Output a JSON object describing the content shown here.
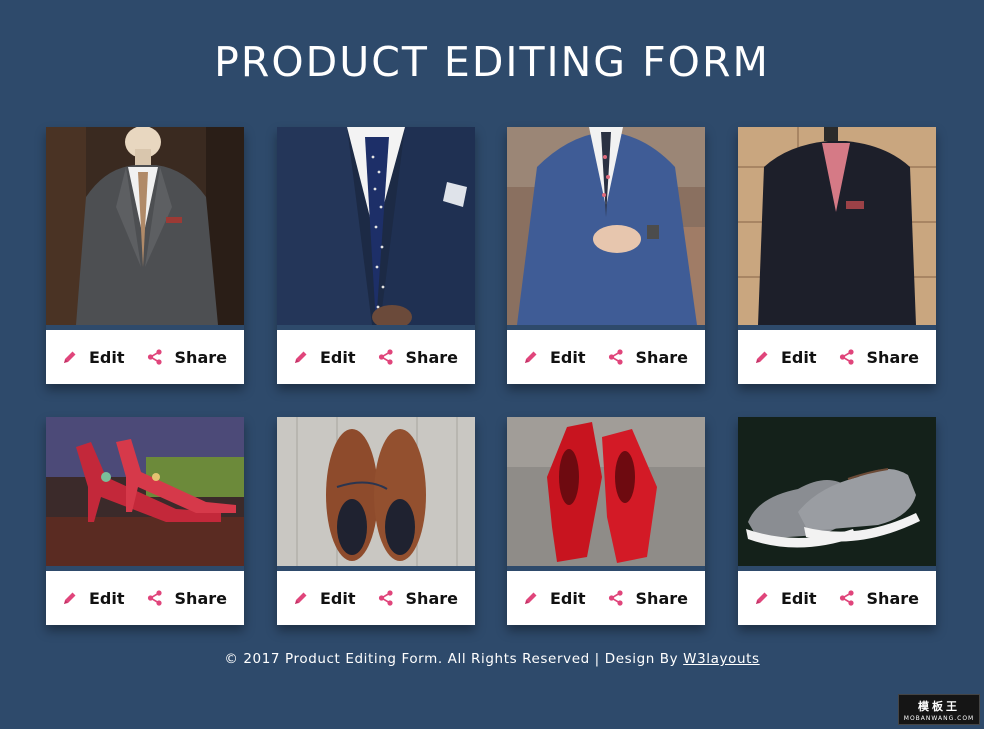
{
  "header": {
    "title": "PRODUCT EDITING FORM"
  },
  "products": [
    {
      "name": "grey-suit-mannequin",
      "edit_label": "Edit",
      "share_label": "Share"
    },
    {
      "name": "navy-suit-polka-tie",
      "edit_label": "Edit",
      "share_label": "Share"
    },
    {
      "name": "blue-suit-floral-tie",
      "edit_label": "Edit",
      "share_label": "Share"
    },
    {
      "name": "black-jacket-hanger",
      "edit_label": "Edit",
      "share_label": "Share"
    },
    {
      "name": "embroidered-red-heels",
      "edit_label": "Edit",
      "share_label": "Share"
    },
    {
      "name": "brown-leather-shoes",
      "edit_label": "Edit",
      "share_label": "Share"
    },
    {
      "name": "glossy-red-pumps",
      "edit_label": "Edit",
      "share_label": "Share"
    },
    {
      "name": "grey-canvas-sneakers",
      "edit_label": "Edit",
      "share_label": "Share"
    }
  ],
  "footer": {
    "text": "© 2017 Product Editing Form. All Rights Reserved | Design By ",
    "link": "W3layouts"
  },
  "watermark": {
    "line1": "模板王",
    "line2": "MOBANWANG.COM"
  },
  "colors": {
    "background": "#2e4a6b",
    "icon_accent": "#e0457b",
    "card": "#ffffff"
  },
  "icons": {
    "edit": "pencil-icon",
    "share": "share-icon"
  }
}
